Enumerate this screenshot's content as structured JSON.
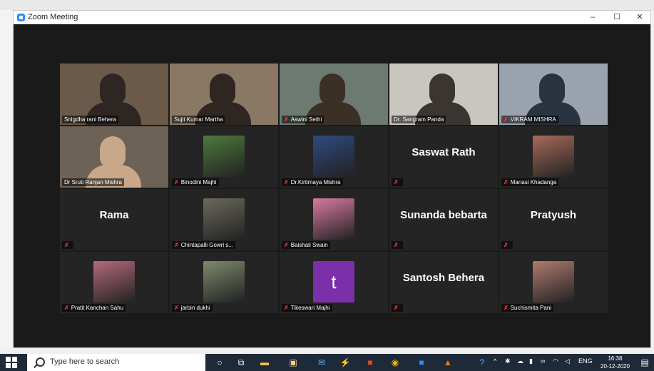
{
  "window": {
    "title": "Zoom Meeting",
    "minimize": "–",
    "maximize": "☐",
    "close": "✕"
  },
  "participants": [
    {
      "name": "Snigdha rani Behera",
      "muted": false,
      "active": true,
      "kind": "video",
      "bg": "#6b5a4a",
      "fg": "#2d2622"
    },
    {
      "name": "Sujit Kumar Martha",
      "muted": false,
      "kind": "video",
      "bg": "#8a7764",
      "fg": "#2f2622"
    },
    {
      "name": "Aswini Sethi",
      "muted": true,
      "kind": "video",
      "bg": "#6c7a72",
      "fg": "#3a3026"
    },
    {
      "name": "Dr. Sangram Panda",
      "muted": false,
      "kind": "video",
      "bg": "#c9c6bf",
      "fg": "#3a3530"
    },
    {
      "name": "VIKRAM MISHRA",
      "muted": true,
      "kind": "video",
      "bg": "#9aa3ad",
      "fg": "#2a3340"
    },
    {
      "name": "Dr Sruti Ranjan Mishra",
      "muted": false,
      "kind": "video",
      "bg": "#6d6256",
      "fg": "#c9a88a"
    },
    {
      "name": "Binodini Majhi",
      "muted": true,
      "kind": "photo",
      "bg": "#4d7a3c"
    },
    {
      "name": "Dr.Kirtimaya Mishra",
      "muted": true,
      "kind": "photo",
      "bg": "#2f4a80"
    },
    {
      "name": "Saswat Rath",
      "muted": true,
      "kind": "text"
    },
    {
      "name": "Manasi Khadanga",
      "muted": true,
      "kind": "photo",
      "bg": "#a86a5a"
    },
    {
      "name": "Rama",
      "muted": true,
      "kind": "text"
    },
    {
      "name": "Chintapalli Gowri s...",
      "muted": true,
      "kind": "photo",
      "bg": "#6c6a5c"
    },
    {
      "name": "Baishali Swain",
      "muted": true,
      "kind": "photo",
      "bg": "#d77aa0"
    },
    {
      "name": "Sunanda bebarta",
      "muted": true,
      "kind": "text"
    },
    {
      "name": "Pratyush",
      "muted": true,
      "kind": "text"
    },
    {
      "name": "Pratit Kanchan Sahu",
      "muted": true,
      "kind": "photo",
      "bg": "#b36a7a"
    },
    {
      "name": "jarbin dukhi",
      "muted": true,
      "kind": "photo",
      "bg": "#7c8a6c"
    },
    {
      "name": "Tikeswari Majhi",
      "muted": true,
      "kind": "letter",
      "letter": "t",
      "bg": "#7b2fa8"
    },
    {
      "name": "Santosh Behera",
      "muted": true,
      "kind": "text"
    },
    {
      "name": "Suchismita Pani",
      "muted": true,
      "kind": "photo",
      "bg": "#b07a70"
    }
  ],
  "taskbar": {
    "search_placeholder": "Type here to search",
    "tray_lang": "ENG",
    "time": "16:38",
    "date": "20-12-2020"
  }
}
